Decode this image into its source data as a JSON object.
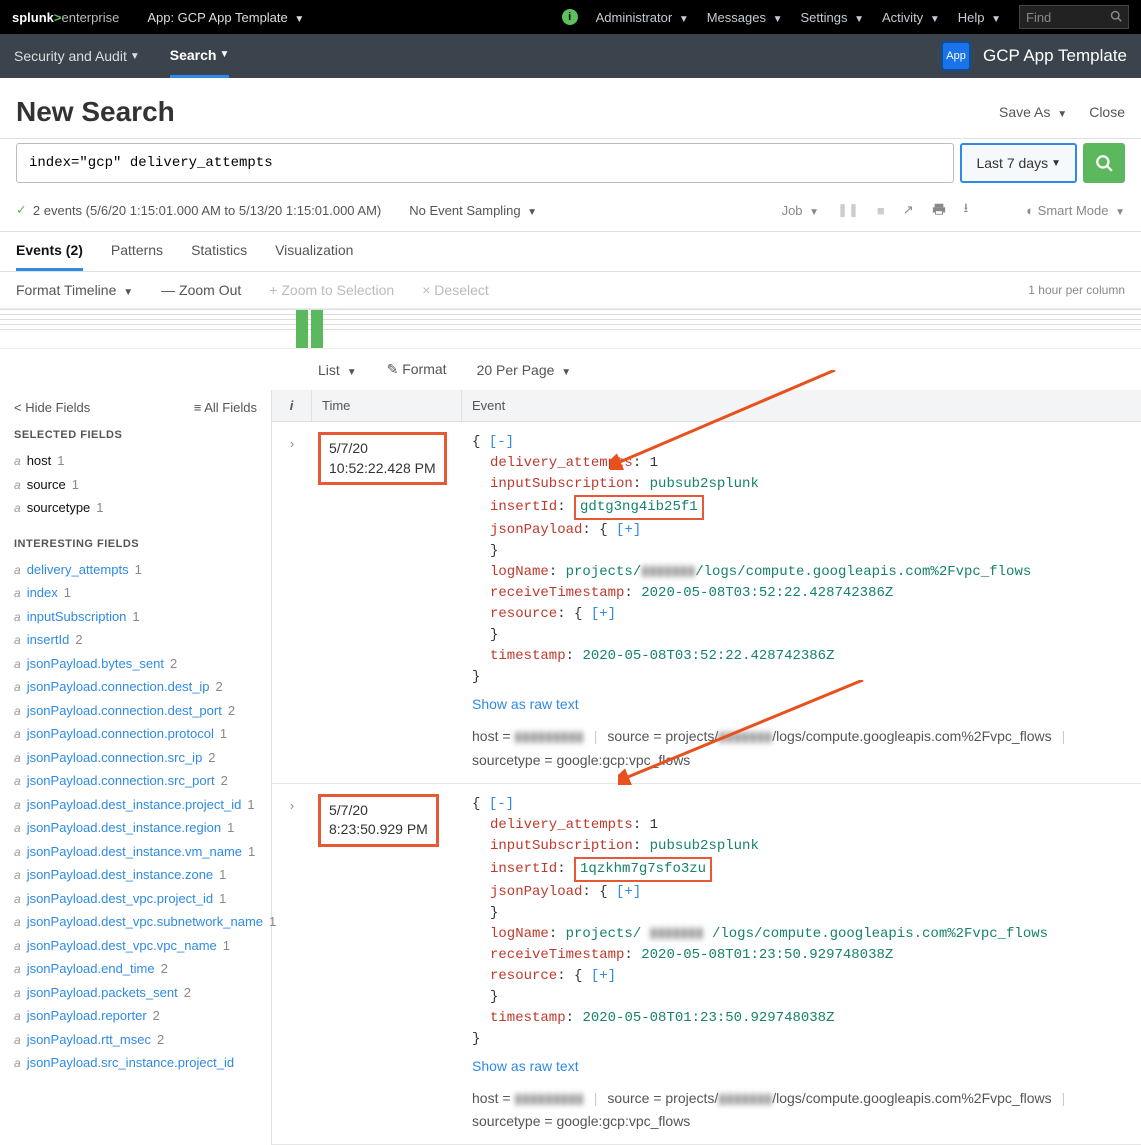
{
  "topbar": {
    "logo_pre": "splunk",
    "logo_post": "enterprise",
    "app_label": "App: GCP App Template",
    "menus": [
      "Administrator",
      "Messages",
      "Settings",
      "Activity",
      "Help"
    ],
    "find_placeholder": "Find"
  },
  "subbar": {
    "tabs": [
      "Security and Audit",
      "Search"
    ],
    "active_index": 1,
    "app_icon_text": "App",
    "app_name": "GCP App Template"
  },
  "page": {
    "title": "New Search",
    "save_as": "Save As",
    "close": "Close"
  },
  "search": {
    "query": "index=\"gcp\" delivery_attempts",
    "time_label": "Last 7 days"
  },
  "status": {
    "events_text": "2 events (5/6/20 1:15:01.000 AM to 5/13/20 1:15:01.000 AM)",
    "sampling": "No Event Sampling",
    "job_label": "Job",
    "smart_mode": "Smart Mode"
  },
  "result_tabs": {
    "items": [
      "Events (2)",
      "Patterns",
      "Statistics",
      "Visualization"
    ],
    "active_index": 0
  },
  "timeline_ctl": {
    "format": "Format Timeline",
    "zoom_out": "Zoom Out",
    "zoom_sel": "Zoom to Selection",
    "deselect": "Deselect",
    "per_column": "1 hour per column"
  },
  "format_row": {
    "list": "List",
    "format": "Format",
    "per_page": "20 Per Page"
  },
  "fields": {
    "hide": "Hide Fields",
    "all": "All Fields",
    "selected_title": "SELECTED FIELDS",
    "selected": [
      {
        "name": "host",
        "count": "1"
      },
      {
        "name": "source",
        "count": "1"
      },
      {
        "name": "sourcetype",
        "count": "1"
      }
    ],
    "interesting_title": "INTERESTING FIELDS",
    "interesting": [
      {
        "name": "delivery_attempts",
        "count": "1"
      },
      {
        "name": "index",
        "count": "1"
      },
      {
        "name": "inputSubscription",
        "count": "1"
      },
      {
        "name": "insertId",
        "count": "2"
      },
      {
        "name": "jsonPayload.bytes_sent",
        "count": "2"
      },
      {
        "name": "jsonPayload.connection.dest_ip",
        "count": "2"
      },
      {
        "name": "jsonPayload.connection.dest_port",
        "count": "2"
      },
      {
        "name": "jsonPayload.connection.protocol",
        "count": "1"
      },
      {
        "name": "jsonPayload.connection.src_ip",
        "count": "2"
      },
      {
        "name": "jsonPayload.connection.src_port",
        "count": "2"
      },
      {
        "name": "jsonPayload.dest_instance.project_id",
        "count": "1"
      },
      {
        "name": "jsonPayload.dest_instance.region",
        "count": "1"
      },
      {
        "name": "jsonPayload.dest_instance.vm_name",
        "count": "1"
      },
      {
        "name": "jsonPayload.dest_instance.zone",
        "count": "1"
      },
      {
        "name": "jsonPayload.dest_vpc.project_id",
        "count": "1"
      },
      {
        "name": "jsonPayload.dest_vpc.subnetwork_name",
        "count": "1"
      },
      {
        "name": "jsonPayload.dest_vpc.vpc_name",
        "count": "1"
      },
      {
        "name": "jsonPayload.end_time",
        "count": "2"
      },
      {
        "name": "jsonPayload.packets_sent",
        "count": "2"
      },
      {
        "name": "jsonPayload.reporter",
        "count": "2"
      },
      {
        "name": "jsonPayload.rtt_msec",
        "count": "2"
      },
      {
        "name": "jsonPayload.src_instance.project_id",
        "count": ""
      }
    ]
  },
  "eventcols": {
    "i": "i",
    "time": "Time",
    "event": "Event"
  },
  "events": [
    {
      "date": "5/7/20",
      "time": "10:52:22.428 PM",
      "delivery_attempts": "1",
      "inputSubscription": "pubsub2splunk",
      "insertId": "gdtg3ng4ib25f1",
      "logName": "projects/***********/logs/compute.googleapis.com%2Fvpc_flows",
      "receiveTimestamp": "2020-05-08T03:52:22.428742386Z",
      "timestamp": "2020-05-08T03:52:22.428742386Z",
      "raw_link": "Show as raw text",
      "host": "*************",
      "source": "projects/***********/logs/compute.googleapis.com%2Fvpc_flows",
      "sourcetype": "google:gcp:vpc_flows"
    },
    {
      "date": "5/7/20",
      "time": "8:23:50.929 PM",
      "delivery_attempts": "1",
      "inputSubscription": "pubsub2splunk",
      "insertId": "1qzkhm7g7sfo3zu",
      "logName": "projects/ *********** /logs/compute.googleapis.com%2Fvpc_flows",
      "receiveTimestamp": "2020-05-08T01:23:50.929748038Z",
      "timestamp": "2020-05-08T01:23:50.929748038Z",
      "raw_link": "Show as raw text",
      "host": "*************",
      "source": "projects/***********/logs/compute.googleapis.com%2Fvpc_flows",
      "sourcetype": "google:gcp:vpc_flows"
    }
  ],
  "labels": {
    "host": "host = ",
    "source": "source = ",
    "sourcetype": "sourcetype = "
  }
}
